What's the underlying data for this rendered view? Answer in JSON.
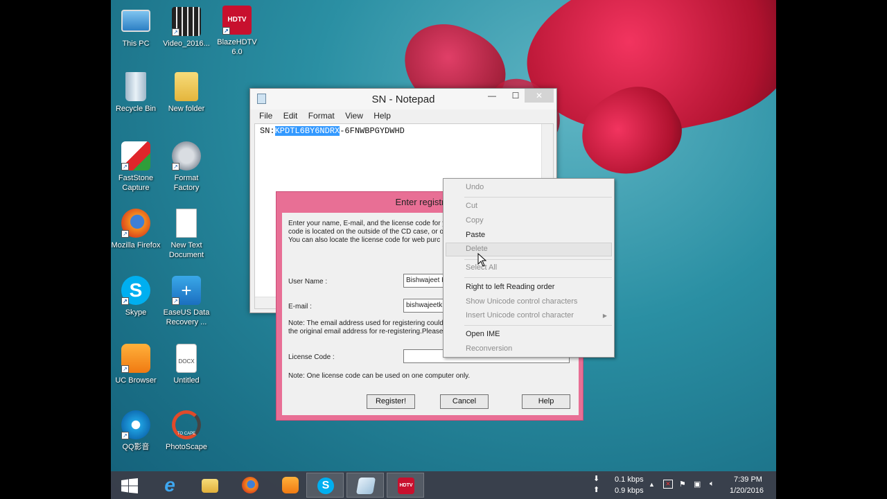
{
  "desktop": {
    "icons": [
      {
        "label": "This PC"
      },
      {
        "label": "Video_2016..."
      },
      {
        "label": "BlazeHDTV 6.0"
      },
      {
        "label": "Recycle Bin"
      },
      {
        "label": "New folder"
      },
      {
        "label": "FastStone Capture"
      },
      {
        "label": "Format Factory"
      },
      {
        "label": "Mozilla Firefox"
      },
      {
        "label": "New Text Document"
      },
      {
        "label": "Skype"
      },
      {
        "label": "EaseUS Data Recovery ..."
      },
      {
        "label": "UC Browser"
      },
      {
        "label": "Untitled"
      },
      {
        "label": "QQ影音"
      },
      {
        "label": "PhotoScape"
      }
    ],
    "hdtv_badge": "HDTV",
    "docx_badge": "DOCX",
    "photoscape_badge": "TO CAPE"
  },
  "notepad": {
    "title": "SN - Notepad",
    "menu": [
      "File",
      "Edit",
      "Format",
      "View",
      "Help"
    ],
    "text_prefix": "SN:",
    "text_selected": "KPDTL6BY6NDRX",
    "text_suffix": "-6FNWBPGYDWHD"
  },
  "registration": {
    "title": "Enter registration",
    "intro": "Enter your name, E-mail, and the license code for y\ncode is located on the outside of the CD case, or o\nYou can also locate the license code for web purc",
    "user_name_label": "User Name :",
    "user_name_value": "Bishwajeet K",
    "email_label": "E-mail :",
    "email_value": "bishwajeetk",
    "email_note": "Note: The email address used for registering could\nthe original email address for re-registering.Please k",
    "license_label": "License Code :",
    "license_value": "",
    "license_note": "Note: One license code can be used on one computer only.",
    "buttons": {
      "register": "Register!",
      "cancel": "Cancel",
      "help": "Help"
    }
  },
  "context_menu": {
    "items": {
      "undo": "Undo",
      "cut": "Cut",
      "copy": "Copy",
      "paste": "Paste",
      "delete": "Delete",
      "select_all": "Select All",
      "rtl": "Right to left Reading order",
      "show_unicode": "Show Unicode control characters",
      "insert_unicode": "Insert Unicode control character",
      "open_ime": "Open IME",
      "reconversion": "Reconversion"
    }
  },
  "taskbar": {
    "network": {
      "down": "0.1 kbps",
      "up": "0.9 kbps"
    },
    "clock": {
      "time": "7:39 PM",
      "date": "1/20/2016"
    },
    "hdtv_badge": "HDTV"
  },
  "colors": {
    "dialog_frame": "#e86f95",
    "selection": "#3399ff",
    "cursor_highlight": "#ffff50"
  }
}
